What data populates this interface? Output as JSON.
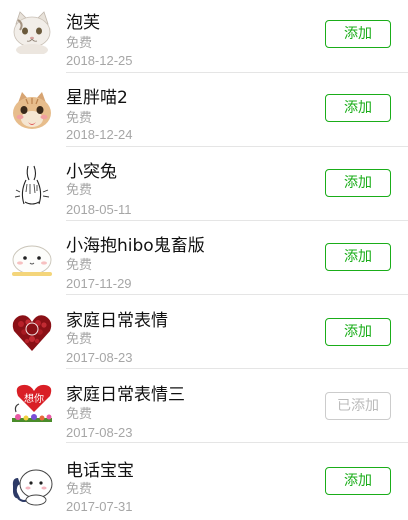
{
  "stickers": [
    {
      "title": "泡芙",
      "price": "免费",
      "date": "2018-12-25",
      "button": "添加",
      "thumb": "cat-white-icon",
      "added": false
    },
    {
      "title": "星胖喵2",
      "price": "免费",
      "date": "2018-12-24",
      "button": "添加",
      "thumb": "cat-orange-icon",
      "added": false
    },
    {
      "title": "小突兔",
      "price": "免费",
      "date": "2018-05-11",
      "button": "添加",
      "thumb": "rabbit-sketch-icon",
      "added": false
    },
    {
      "title": "小海抱hibo鬼畜版",
      "price": "免费",
      "date": "2017-11-29",
      "button": "添加",
      "thumb": "seal-icon",
      "added": false
    },
    {
      "title": "家庭日常表情",
      "price": "免费",
      "date": "2017-08-23",
      "button": "添加",
      "thumb": "rose-heart-icon",
      "added": false
    },
    {
      "title": "家庭日常表情三",
      "price": "免费",
      "date": "2017-08-23",
      "button": "已添加",
      "thumb": "heart-flowers-icon",
      "added": true
    },
    {
      "title": "电话宝宝",
      "price": "免费",
      "date": "2017-07-31",
      "button": "添加",
      "thumb": "phone-baby-icon",
      "added": false
    }
  ],
  "thumb_text": {
    "heart_word": "想你"
  },
  "colors": {
    "accent": "#1aad19",
    "disabled": "#bbbbbb",
    "muted": "#a6a6a6"
  }
}
